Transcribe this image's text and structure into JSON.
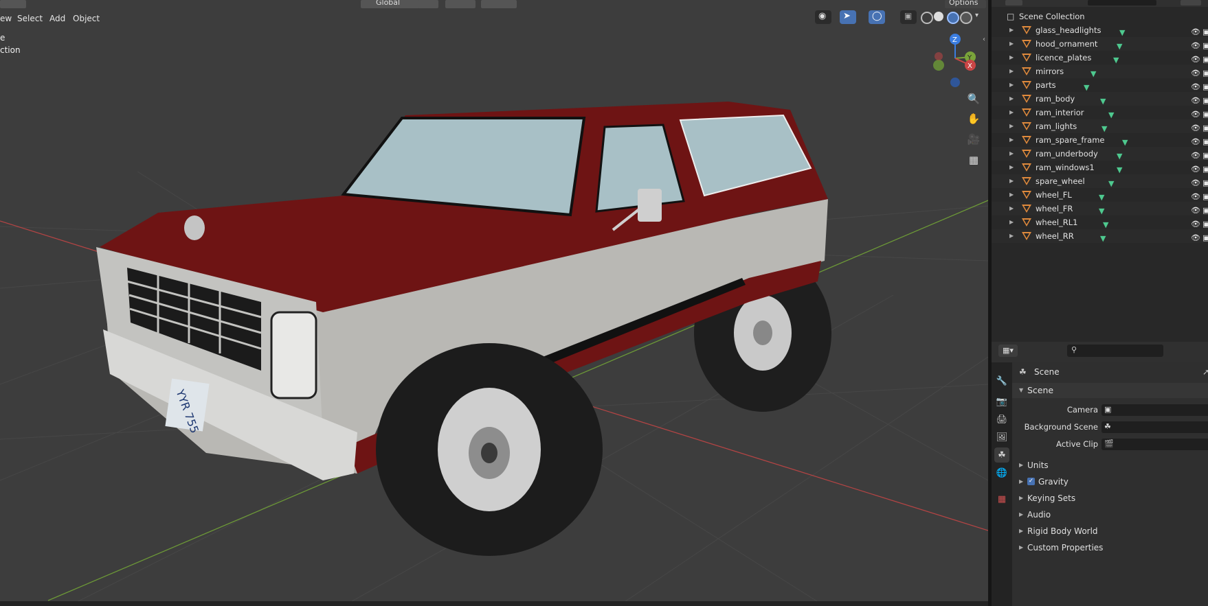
{
  "viewport": {
    "menu": [
      "ew",
      "Select",
      "Add",
      "Object"
    ],
    "transform_orientation": "Global",
    "top_right_label": "Options",
    "overlay_line1": "e",
    "overlay_line2": "ction",
    "gizmo_axes": [
      "Z",
      "Y",
      "X"
    ],
    "nav_icons": [
      "zoom-icon",
      "hand-pan-icon",
      "camera-icon",
      "grid-icon"
    ],
    "license_plate_text": "YYR 755",
    "colors": {
      "grid_x": "#c94545",
      "grid_y": "#7aa43a",
      "body_red": "#6e1414",
      "body_gray": "#b9b8b4"
    }
  },
  "outliner": {
    "collection": "Scene Collection",
    "items": [
      {
        "label": "glass_headlights"
      },
      {
        "label": "hood_ornament"
      },
      {
        "label": "licence_plates"
      },
      {
        "label": "mirrors"
      },
      {
        "label": "parts"
      },
      {
        "label": "ram_body"
      },
      {
        "label": "ram_interior"
      },
      {
        "label": "ram_lights"
      },
      {
        "label": "ram_spare_frame"
      },
      {
        "label": "ram_underbody"
      },
      {
        "label": "ram_windows1"
      },
      {
        "label": "spare_wheel"
      },
      {
        "label": "wheel_FL"
      },
      {
        "label": "wheel_FR"
      },
      {
        "label": "wheel_RL1"
      },
      {
        "label": "wheel_RR"
      }
    ]
  },
  "properties": {
    "context": "Scene",
    "panel_title": "Scene",
    "fields": [
      {
        "label": "Camera"
      },
      {
        "label": "Background Scene"
      },
      {
        "label": "Active Clip"
      }
    ],
    "sections": [
      {
        "label": "Units",
        "checkbox": false
      },
      {
        "label": "Gravity",
        "checkbox": true
      },
      {
        "label": "Keying Sets",
        "checkbox": false
      },
      {
        "label": "Audio",
        "checkbox": false
      },
      {
        "label": "Rigid Body World",
        "checkbox": false
      },
      {
        "label": "Custom Properties",
        "checkbox": false
      }
    ]
  }
}
